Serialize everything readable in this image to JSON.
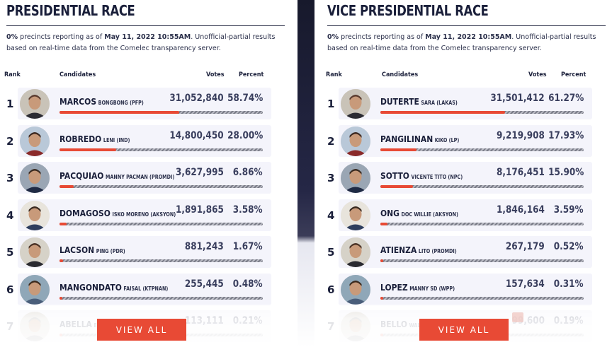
{
  "notice": {
    "prefix": "0%",
    "text1": " precincts reporting as of ",
    "date": "May 11, 2022 10:55AM",
    "text2": ". Unofficial-partial results based on real-time data from the Comelec transparency server."
  },
  "headers": {
    "rank": "Rank",
    "candidates": "Candidates",
    "votes": "Votes",
    "percent": "Percent"
  },
  "view_all_label": "VIEW ALL",
  "colors": {
    "accent": "#e84a35",
    "navy": "#1a1f3a",
    "card": "#f4f4fb"
  },
  "presidential": {
    "title": "PRESIDENTIAL RACE",
    "rows": [
      {
        "rank": "1",
        "last": "MARCOS",
        "first": "BONGBONG (PFP)",
        "votes": "31,052,840",
        "percent": "58.74%",
        "share": 0.5874
      },
      {
        "rank": "2",
        "last": "ROBREDO",
        "first": "LENI (IND)",
        "votes": "14,800,450",
        "percent": "28.00%",
        "share": 0.28
      },
      {
        "rank": "3",
        "last": "PACQUIAO",
        "first": "MANNY PACMAN (PROMDI)",
        "votes": "3,627,995",
        "percent": "6.86%",
        "share": 0.0686
      },
      {
        "rank": "4",
        "last": "DOMAGOSO",
        "first": "ISKO MORENO (AKSYON)",
        "votes": "1,891,865",
        "percent": "3.58%",
        "share": 0.0358
      },
      {
        "rank": "5",
        "last": "LACSON",
        "first": "PING (PDR)",
        "votes": "881,243",
        "percent": "1.67%",
        "share": 0.0167
      },
      {
        "rank": "6",
        "last": "MANGONDATO",
        "first": "FAISAL (KTPNAN)",
        "votes": "255,445",
        "percent": "0.48%",
        "share": 0.0048
      },
      {
        "rank": "7",
        "last": "ABELLA",
        "first": "ERI",
        "votes": "113,111",
        "percent": "0.21%",
        "share": 0.0021
      }
    ]
  },
  "vice_presidential": {
    "title": "VICE PRESIDENTIAL RACE",
    "rows": [
      {
        "rank": "1",
        "last": "DUTERTE",
        "first": "SARA (LAKAS)",
        "votes": "31,501,412",
        "percent": "61.27%",
        "share": 0.6127
      },
      {
        "rank": "2",
        "last": "PANGILINAN",
        "first": "KIKO (LP)",
        "votes": "9,219,908",
        "percent": "17.93%",
        "share": 0.1793
      },
      {
        "rank": "3",
        "last": "SOTTO",
        "first": "VICENTE TITO (NPC)",
        "votes": "8,176,451",
        "percent": "15.90%",
        "share": 0.159
      },
      {
        "rank": "4",
        "last": "ONG",
        "first": "DOC WILLIE (AKSYON)",
        "votes": "1,846,164",
        "percent": "3.59%",
        "share": 0.0359
      },
      {
        "rank": "5",
        "last": "ATIENZA",
        "first": "LITO (PROMDI)",
        "votes": "267,179",
        "percent": "0.52%",
        "share": 0.0052
      },
      {
        "rank": "6",
        "last": "LOPEZ",
        "first": "MANNY SD (WPP)",
        "votes": "157,634",
        "percent": "0.31%",
        "share": 0.0031
      },
      {
        "rank": "7",
        "last": "BELLO",
        "first": "WALD",
        "votes": "99,600",
        "percent": "0.19%",
        "share": 0.0019
      }
    ]
  }
}
